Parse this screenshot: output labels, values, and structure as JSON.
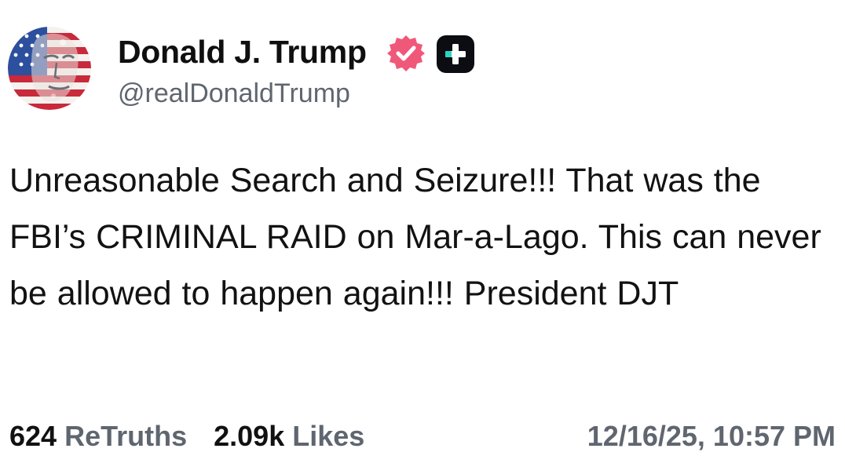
{
  "author": {
    "display_name": "Donald J. Trump",
    "handle": "@realDonaldTrump",
    "verified_color": "#f0587a",
    "plus_badge_color": "#0b0d12",
    "plus_badge_accent": "#2bd5c0"
  },
  "post": {
    "text": "Unreasonable Search and Seizure!!! That was the FBI’s CRIMINAL RAID on Mar-a-Lago. This can never be allowed to happen again!!! President DJT"
  },
  "stats": {
    "retruths_count": "624",
    "retruths_label": "ReTruths",
    "likes_count": "2.09k",
    "likes_label": "Likes"
  },
  "timestamp": "12/16/25, 10:57 PM",
  "icons": {
    "avatar": "profile-photo",
    "verified": "verified-badge-icon",
    "plus": "truth-plus-icon"
  }
}
